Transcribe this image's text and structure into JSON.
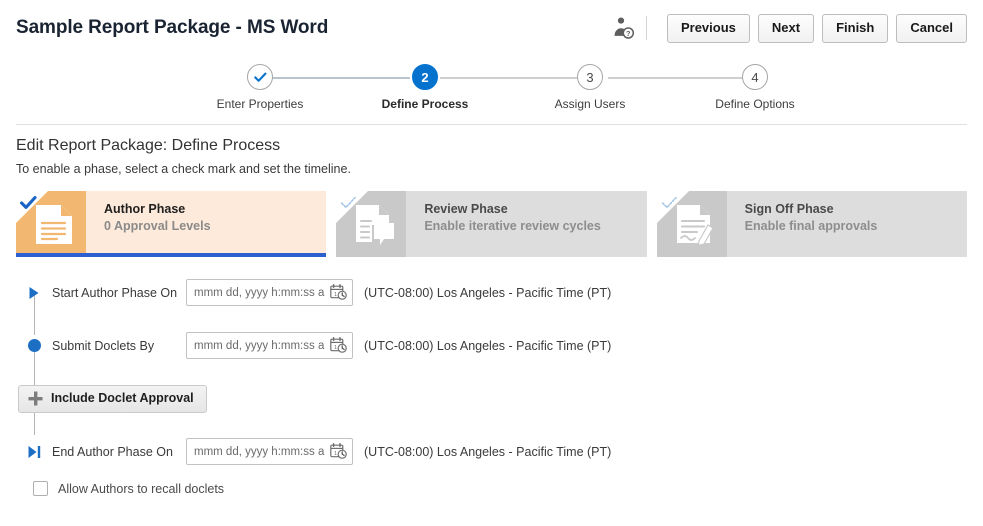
{
  "header": {
    "title": "Sample Report Package - MS Word",
    "help_icon": "user-help-icon",
    "buttons": [
      {
        "label": "Previous",
        "name": "previous-button"
      },
      {
        "label": "Next",
        "name": "next-button"
      },
      {
        "label": "Finish",
        "name": "finish-button"
      },
      {
        "label": "Cancel",
        "name": "cancel-button"
      }
    ]
  },
  "stepper": {
    "steps": [
      {
        "number": "1",
        "label": "Enter Properties",
        "state": "done"
      },
      {
        "number": "2",
        "label": "Define Process",
        "state": "active"
      },
      {
        "number": "3",
        "label": "Assign Users",
        "state": "todo"
      },
      {
        "number": "4",
        "label": "Define Options",
        "state": "todo"
      }
    ],
    "active_color": "#0572ce"
  },
  "section": {
    "title": "Edit Report Package: Define Process",
    "subtitle": "To enable a phase, select a check mark and set the timeline."
  },
  "phases": [
    {
      "name": "Author Phase",
      "desc": "0 Approval Levels",
      "state": "active",
      "icon": "document-icon",
      "check": "checkmark-icon",
      "accent": "#2c5fd0",
      "icon_bg": "#f2b872",
      "body_bg": "#fdeada"
    },
    {
      "name": "Review Phase",
      "desc": "Enable iterative review cycles",
      "state": "inactive",
      "icon": "document-comment-icon",
      "check": "checkmark-outline-icon",
      "icon_bg": "#c9c9c9",
      "body_bg": "#dddddd"
    },
    {
      "name": "Sign Off Phase",
      "desc": "Enable final approvals",
      "state": "inactive",
      "icon": "document-signature-icon",
      "check": "checkmark-outline-icon",
      "icon_bg": "#c9c9c9",
      "body_bg": "#dddddd"
    }
  ],
  "timeline": {
    "timezone": "(UTC-08:00) Los Angeles - Pacific Time (PT)",
    "date_placeholder": "mmm dd, yyyy h:mm:ss a z",
    "rows": [
      {
        "label": "Start Author Phase On",
        "marker": "play-triangle-icon",
        "value": ""
      },
      {
        "label": "Submit Doclets By",
        "marker": "filled-circle-icon",
        "value": ""
      },
      {
        "label": "End Author Phase On",
        "marker": "end-triangle-icon",
        "value": ""
      }
    ],
    "approval_button": "Include Doclet Approval",
    "approval_icon": "plus-icon",
    "checkbox_label": "Allow Authors to recall doclets",
    "checkbox_checked": false
  }
}
